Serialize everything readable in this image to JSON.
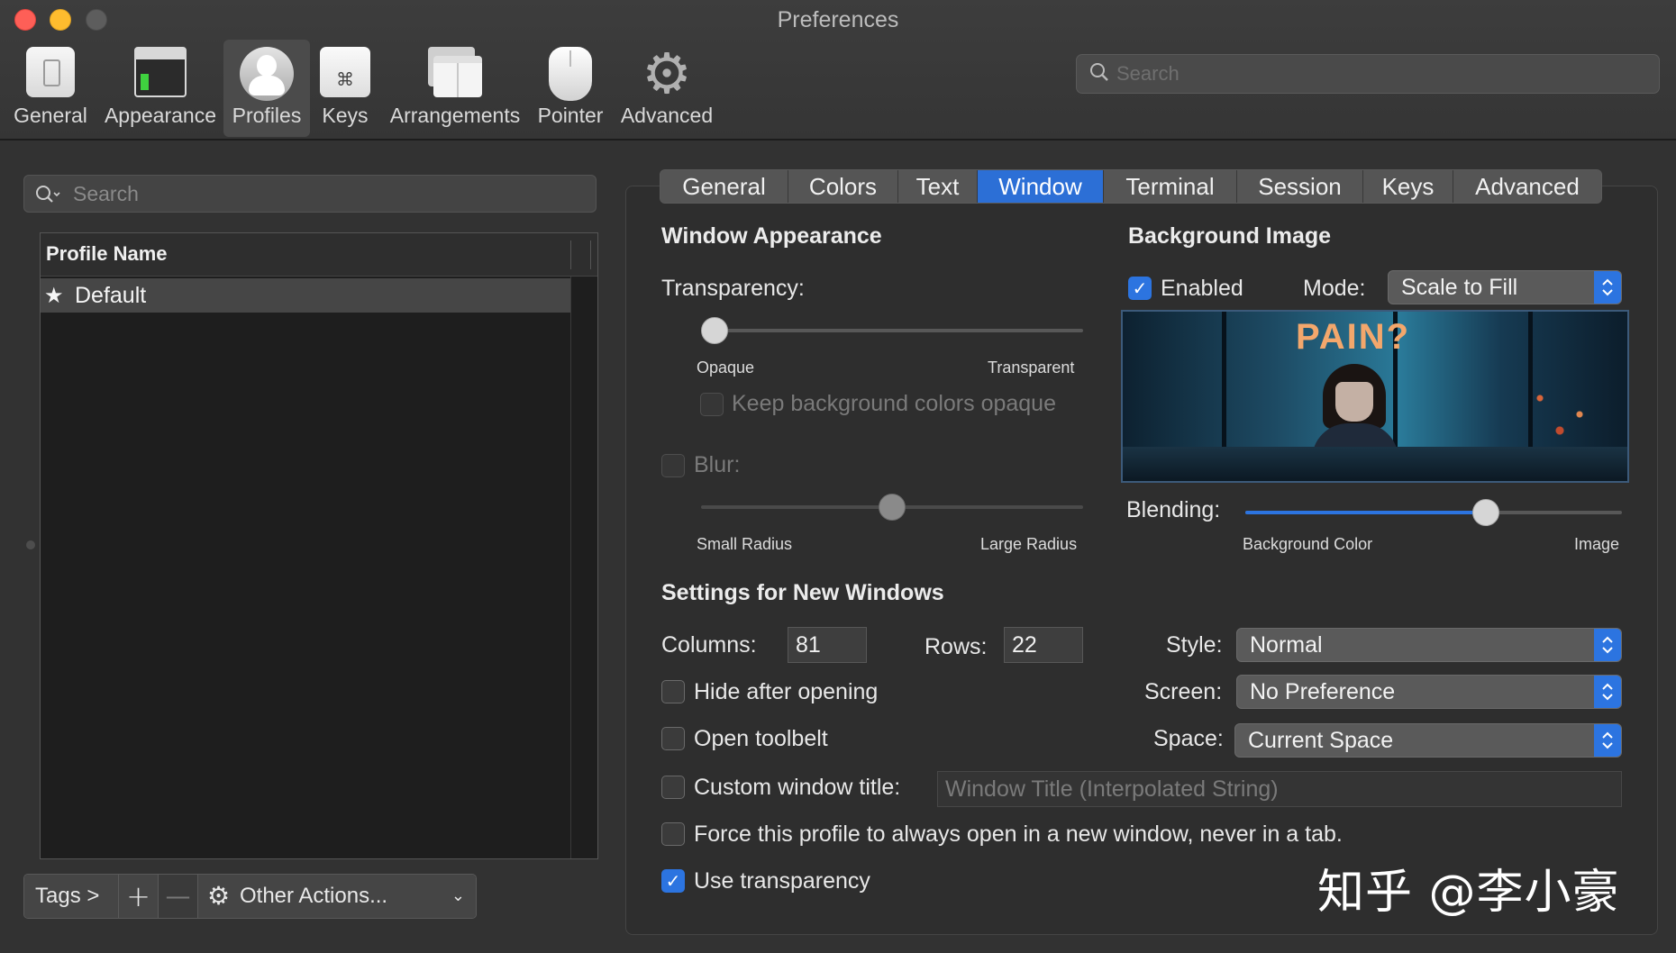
{
  "window": {
    "title": "Preferences"
  },
  "toolbar": {
    "items": [
      {
        "label": "General"
      },
      {
        "label": "Appearance"
      },
      {
        "label": "Profiles",
        "selected": true
      },
      {
        "label": "Keys",
        "glyph": "⌘"
      },
      {
        "label": "Arrangements"
      },
      {
        "label": "Pointer"
      },
      {
        "label": "Advanced",
        "glyph": "⚙"
      }
    ],
    "search_placeholder": "Search"
  },
  "profiles": {
    "search_placeholder": "Search",
    "column_header": "Profile Name",
    "rows": [
      {
        "name": "Default",
        "glyph": "★",
        "selected": true
      }
    ],
    "bottom": {
      "tags": "Tags >",
      "add": "+",
      "remove": "—",
      "other_actions": "Other Actions...",
      "gear": "⚙",
      "chevron": "⌄"
    }
  },
  "tabs": [
    "General",
    "Colors",
    "Text",
    "Window",
    "Terminal",
    "Session",
    "Keys",
    "Advanced"
  ],
  "active_tab": "Window",
  "window_appearance": {
    "heading": "Window Appearance",
    "transparency_label": "Transparency:",
    "transparency_value": 0.0,
    "transparency_min_label": "Opaque",
    "transparency_max_label": "Transparent",
    "keep_bg_opaque_label": "Keep background colors opaque",
    "keep_bg_opaque_checked": false,
    "blur_label": "Blur:",
    "blur_checked": false,
    "blur_value": 0.5,
    "blur_min_label": "Small Radius",
    "blur_max_label": "Large Radius"
  },
  "background_image": {
    "heading": "Background Image",
    "enabled_label": "Enabled",
    "enabled_checked": true,
    "mode_label": "Mode:",
    "mode_value": "Scale to Fill",
    "preview_sign_text": "PAIN?",
    "blending_label": "Blending:",
    "blending_value": 0.65,
    "blending_min_label": "Background Color",
    "blending_max_label": "Image"
  },
  "new_windows": {
    "heading": "Settings for New Windows",
    "columns_label": "Columns:",
    "columns_value": "81",
    "rows_label": "Rows:",
    "rows_value": "22",
    "style_label": "Style:",
    "style_value": "Normal",
    "screen_label": "Screen:",
    "screen_value": "No Preference",
    "space_label": "Space:",
    "space_value": "Current Space",
    "hide_after_opening_label": "Hide after opening",
    "hide_after_opening_checked": false,
    "open_toolbelt_label": "Open toolbelt",
    "open_toolbelt_checked": false,
    "custom_title_label": "Custom window title:",
    "custom_title_checked": false,
    "custom_title_placeholder": "Window Title (Interpolated String)",
    "force_new_window_label": "Force this profile to always open in a new window, never in a tab.",
    "force_new_window_checked": false,
    "use_transparency_label": "Use transparency",
    "use_transparency_checked": true
  },
  "watermark": "知乎 @李小豪",
  "colors": {
    "accent": "#2c74e0",
    "background": "#323232",
    "close": "#fe5f57",
    "minimize": "#febc2e"
  }
}
